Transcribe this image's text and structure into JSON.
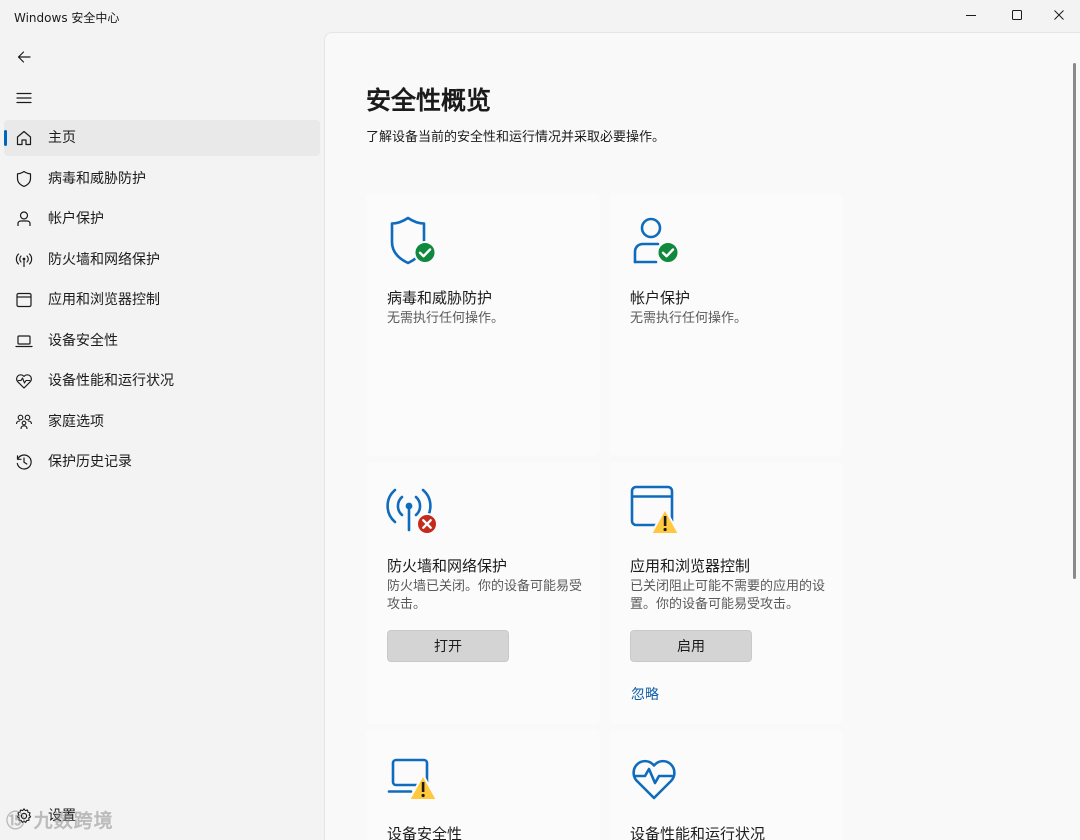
{
  "window": {
    "title": "Windows 安全中心"
  },
  "sidebar": {
    "items": [
      {
        "label": "主页",
        "icon": "home-icon",
        "selected": true
      },
      {
        "label": "病毒和威胁防护",
        "icon": "shield-icon"
      },
      {
        "label": "帐户保护",
        "icon": "person-icon"
      },
      {
        "label": "防火墙和网络保护",
        "icon": "antenna-icon"
      },
      {
        "label": "应用和浏览器控制",
        "icon": "browser-window-icon"
      },
      {
        "label": "设备安全性",
        "icon": "laptop-icon"
      },
      {
        "label": "设备性能和运行状况",
        "icon": "heart-pulse-icon"
      },
      {
        "label": "家庭选项",
        "icon": "family-icon"
      },
      {
        "label": "保护历史记录",
        "icon": "history-icon"
      }
    ],
    "settings_label": "设置"
  },
  "main": {
    "title": "安全性概览",
    "subtitle": "了解设备当前的安全性和运行情况并采取必要操作。",
    "cards": [
      {
        "title": "病毒和威胁防护",
        "desc": "无需执行任何操作。",
        "status": "ok"
      },
      {
        "title": "帐户保护",
        "desc": "无需执行任何操作。",
        "status": "ok"
      },
      {
        "title": "防火墙和网络保护",
        "desc": "防火墙已关闭。你的设备可能易受攻击。",
        "status": "error",
        "button": "打开"
      },
      {
        "title": "应用和浏览器控制",
        "desc": "已关闭阻止可能不需要的应用的设置。你的设备可能易受攻击。",
        "status": "warning",
        "button": "启用",
        "link": "忽略"
      },
      {
        "title": "设备安全性",
        "status": "warning"
      },
      {
        "title": "设备性能和运行状况",
        "status": "none"
      }
    ]
  },
  "watermark": "⑮ 九数跨境",
  "colors": {
    "accent": "#0067c0",
    "icon_blue": "#0f6cbd",
    "ok": "#10893e",
    "error": "#c42b1c",
    "warning": "#ffc83d",
    "link": "#0f5ea8"
  }
}
